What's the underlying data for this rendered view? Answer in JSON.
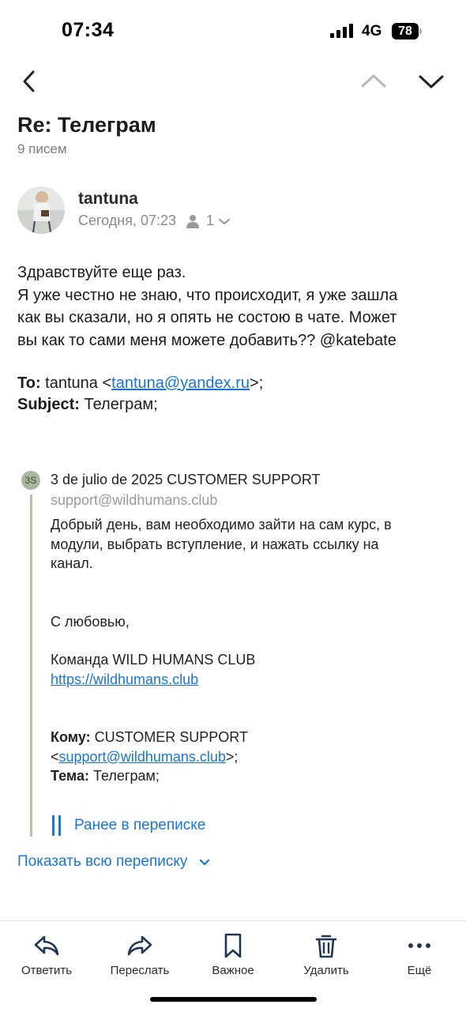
{
  "status_bar": {
    "time": "07:34",
    "network": "4G",
    "battery": "78"
  },
  "header": {
    "subject": "Re: Телеграм",
    "message_count": "9 писем"
  },
  "message": {
    "sender": "tantuna",
    "date": "Сегодня, 07:23",
    "recipients_count": "1",
    "body_lines": [
      "Здравствуйте еще раз.",
      "Я уже честно не знаю, что происходит, я уже зашла",
      "как вы сказали, но я опять не состою в чате. Может",
      "вы как то сами меня можете добавить?? @katebate"
    ],
    "to_label": "To:",
    "to_name": "tantuna <",
    "to_email": "tantuna@yandex.ru",
    "to_suffix": ">;",
    "subject_label": "Subject:",
    "subject_value": "Телеграм;"
  },
  "quoted": {
    "initials": "3S",
    "title": "3 de julio de 2025 CUSTOMER SUPPORT",
    "email": "support@wildhumans.club",
    "text_lines": [
      "Добрый день, вам необходимо зайти на сам курс, в",
      "модули, выбрать вступление, и нажать ссылку на",
      "канал."
    ],
    "signoff": "С любовью,",
    "team": "Команда WILD HUMANS CLUB",
    "link": "https://wildhumans.club",
    "to_label": "Кому:",
    "to_name": "CUSTOMER SUPPORT",
    "to_email": "support@wildhumans.club",
    "to_open": "<",
    "to_close": ">;",
    "subject_label": "Тема:",
    "subject_value": "Телеграм;",
    "earlier_label": "Ранее в переписке"
  },
  "show_all": "Показать всю переписку",
  "toolbar": {
    "reply": "Ответить",
    "forward": "Переслать",
    "important": "Важное",
    "delete": "Удалить",
    "more": "Ещё"
  },
  "colors": {
    "accent": "#1976d2",
    "quote_bar": "#b9bfa9"
  }
}
